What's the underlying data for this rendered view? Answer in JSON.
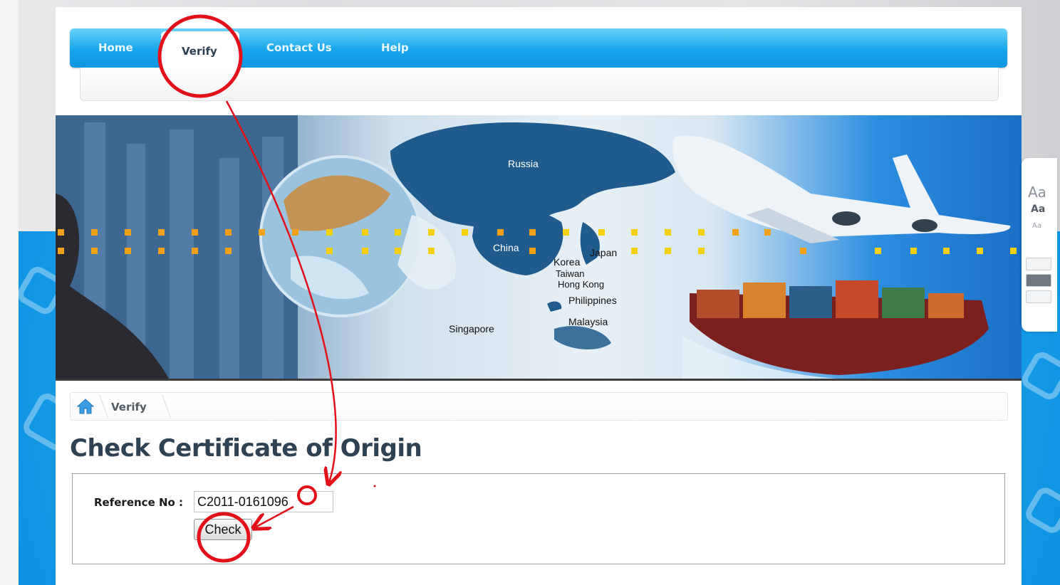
{
  "nav": {
    "items": [
      "Home",
      "Verify",
      "Contact Us",
      "Help"
    ],
    "active": "Verify"
  },
  "banner": {
    "map_labels": {
      "russia": "Russia",
      "china": "China",
      "japan": "Japan",
      "korea": "Korea",
      "taiwan": "Taiwan",
      "hongkong": "Hong Kong",
      "philippines": "Philippines",
      "malaysia": "Malaysia",
      "singapore": "Singapore"
    }
  },
  "breadcrumb": {
    "home_icon": "home-icon",
    "current": "Verify"
  },
  "page": {
    "title": "Check Certificate of Origin"
  },
  "form": {
    "reference_label": "Reference No :",
    "reference_value": "C2011-0161096",
    "check_label": "Check"
  },
  "font_size_widget": {
    "large": "Aa",
    "medium": "Aa",
    "small": "Aa"
  },
  "colors": {
    "nav_blue": "#16a5ea",
    "title_dark": "#2e4253",
    "annotation_red": "#e3101a"
  }
}
